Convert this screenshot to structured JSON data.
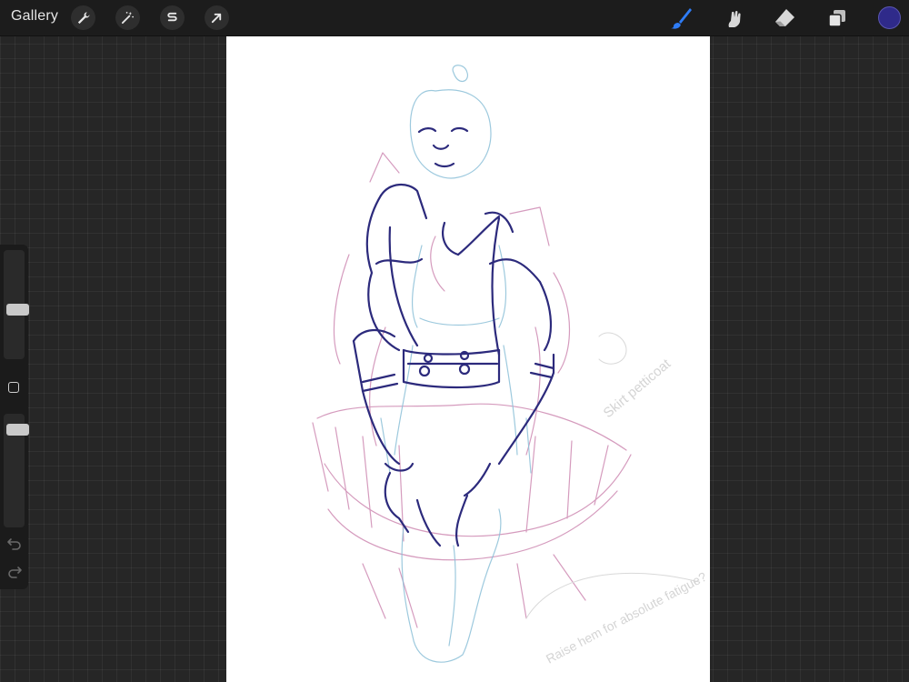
{
  "topbar": {
    "gallery_label": "Gallery",
    "left_tools": [
      "wrench-icon",
      "magic-wand-icon",
      "selection-s-icon",
      "transform-arrow-icon"
    ],
    "right_tools": [
      "brush-icon",
      "smudge-icon",
      "eraser-icon",
      "layers-icon"
    ],
    "active_tool": "brush",
    "current_color": "#2f2a8a",
    "active_tool_color": "#2e7cf6"
  },
  "sidebar": {
    "brush_size_level": 0.45,
    "brush_opacity_level": 0.9,
    "icons": [
      "modify-square-icon",
      "undo-icon",
      "redo-icon"
    ]
  },
  "canvas": {
    "background": "#ffffff",
    "sketch_note_1": "Skirt petticoat",
    "sketch_note_2": "Raise hem for absolute fatigue?"
  }
}
